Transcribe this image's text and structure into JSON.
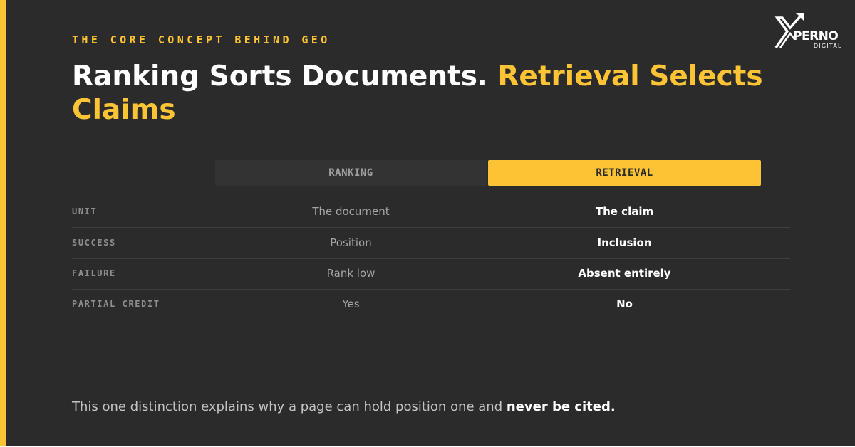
{
  "eyebrow": "THE CORE CONCEPT BEHIND GEO",
  "headline": {
    "part1": "Ranking Sorts Documents. ",
    "part2": "Retrieval Selects Claims"
  },
  "logo": {
    "word": "PERNO",
    "sub": "DIGITAL",
    "icon": "x-arrow-logo-icon"
  },
  "columns": {
    "ranking": "RANKING",
    "retrieval": "RETRIEVAL"
  },
  "rows": [
    {
      "label": "UNIT",
      "ranking": "The document",
      "retrieval": "The claim"
    },
    {
      "label": "SUCCESS",
      "ranking": "Position",
      "retrieval": "Inclusion"
    },
    {
      "label": "FAILURE",
      "ranking": "Rank low",
      "retrieval": "Absent entirely"
    },
    {
      "label": "PARTIAL CREDIT",
      "ranking": "Yes",
      "retrieval": "No"
    }
  ],
  "footer": {
    "text": "This one distinction explains why a page can hold position one and ",
    "emphasis": "never be cited."
  },
  "colors": {
    "accent": "#fcc434",
    "background": "#2b2b2b",
    "text": "#ffffff"
  }
}
